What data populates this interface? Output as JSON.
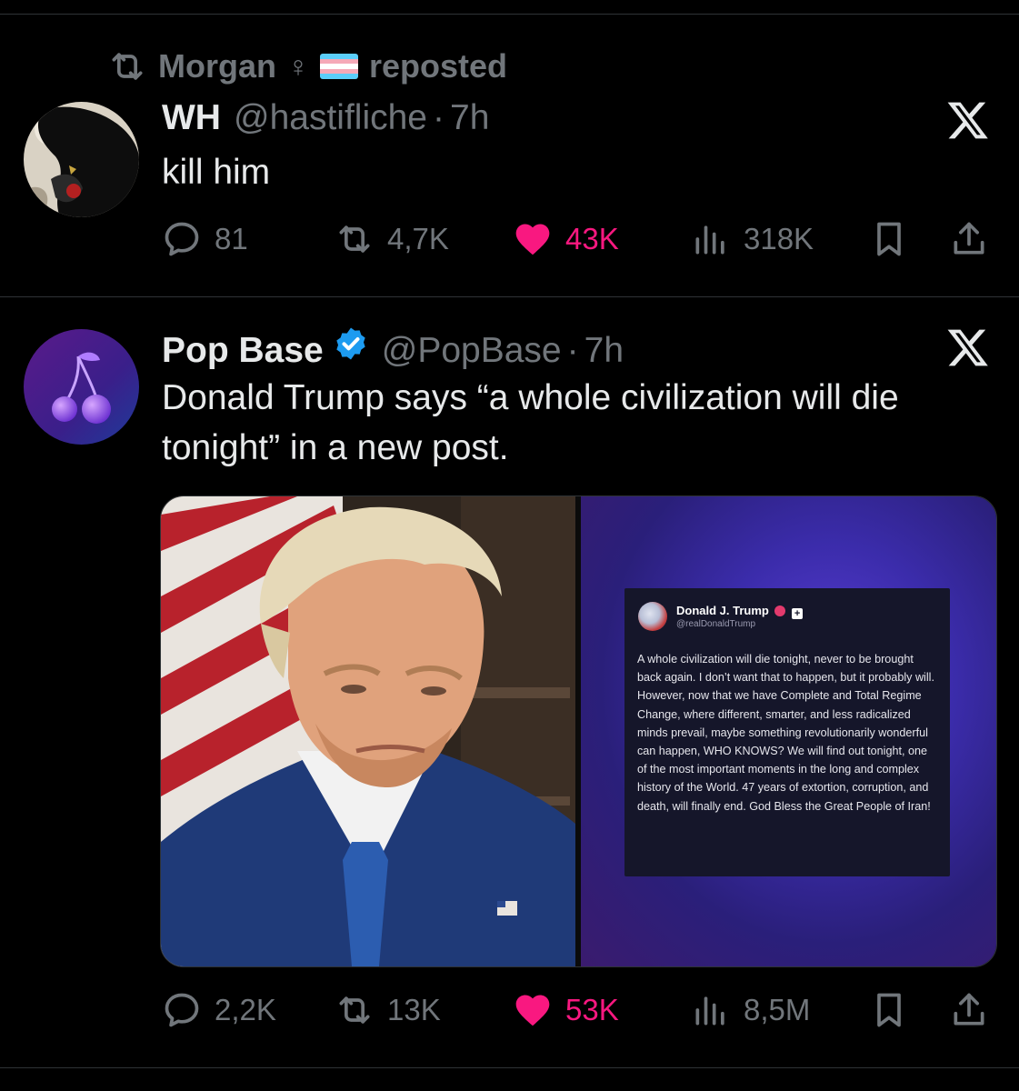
{
  "repost": {
    "user": "Morgan",
    "symbol": "♀",
    "label": "reposted"
  },
  "tweet1": {
    "name": "WH",
    "handle": "@hastifliche",
    "dot": "·",
    "time": "7h",
    "text": "kill him",
    "stats": {
      "replies": "81",
      "reposts": "4,7K",
      "likes": "43K",
      "views": "318K"
    }
  },
  "tweet2": {
    "name": "Pop Base",
    "handle": "@PopBase",
    "dot": "·",
    "time": "7h",
    "text": "Donald Trump says “a whole civilization will die tonight” in a new post.",
    "stats": {
      "replies": "2,2K",
      "reposts": "13K",
      "likes": "53K",
      "views": "8,5M"
    },
    "quoted_post": {
      "name": "Donald J. Trump",
      "plus": "+",
      "handle": "@realDonaldTrump",
      "text": "A whole civilization will die tonight, never to be brought back again. I don’t want that to happen, but it probably will. However, now that we have Complete and Total Regime Change, where different, smarter, and less radicalized minds prevail, maybe something revolutionarily wonderful can happen, WHO KNOWS? We will find out tonight, one of the most important moments in the long and complex history of the World. 47 years of extortion, corruption, and death, will finally end. God Bless the Great People of Iran!"
    }
  },
  "colors": {
    "background": "#000000",
    "text": "#e7e9ea",
    "muted": "#71767b",
    "like": "#f91880",
    "verified": "#1d9bf0",
    "divider": "#2f3336"
  },
  "icons": [
    "repost-icon",
    "reply-icon",
    "like-icon",
    "views-icon",
    "bookmark-icon",
    "share-icon",
    "x-logo-icon",
    "verified-badge-icon"
  ]
}
